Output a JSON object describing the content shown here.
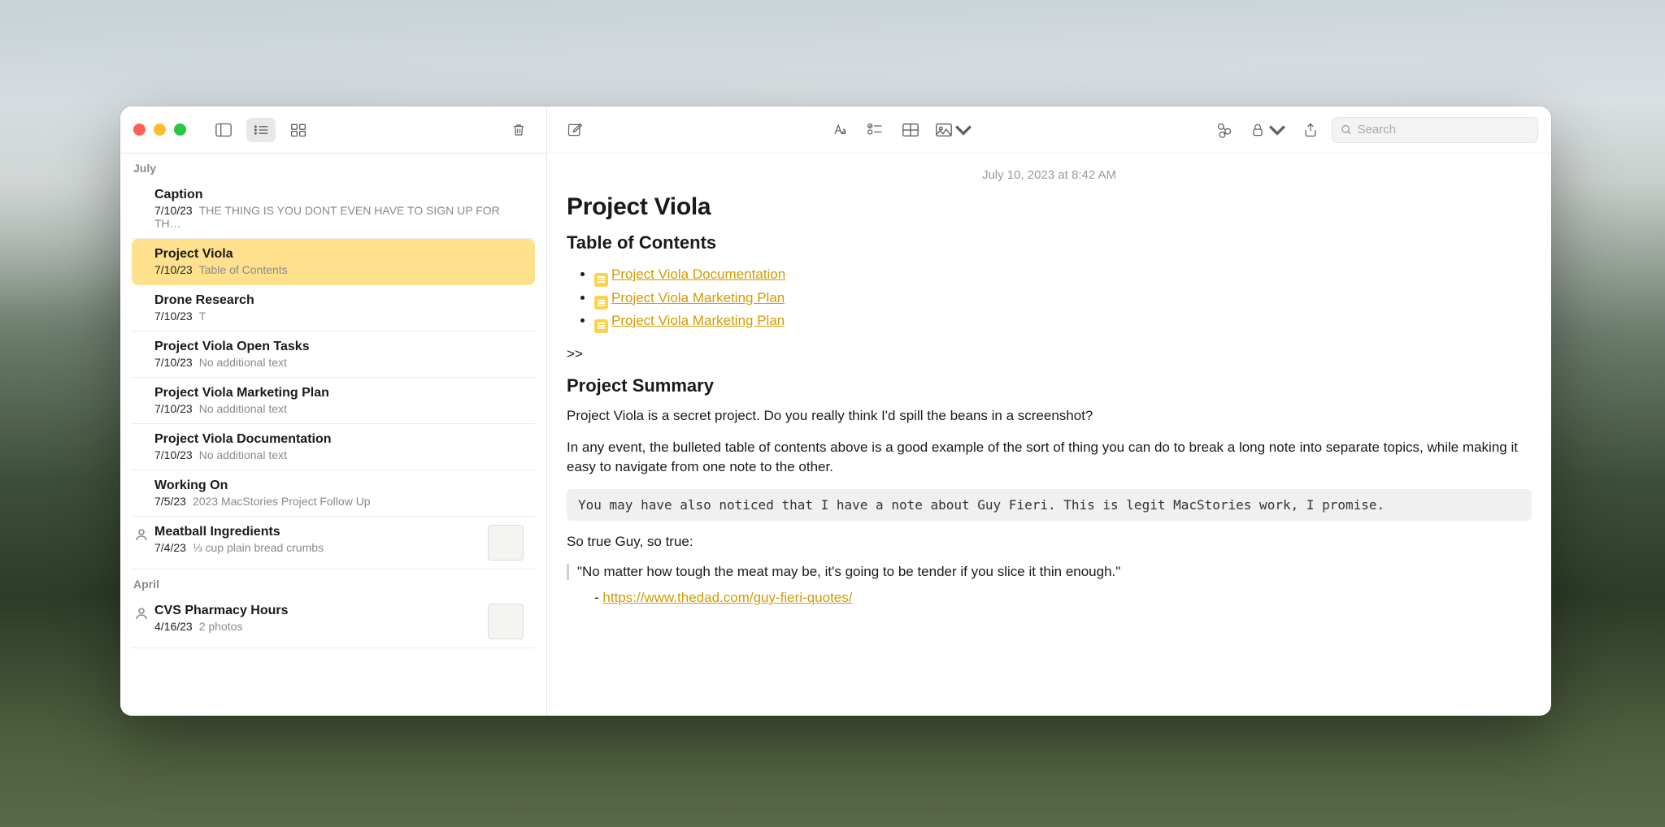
{
  "sidebar": {
    "groups": [
      {
        "label": "July",
        "items": [
          {
            "title": "Caption",
            "date": "7/10/23",
            "preview": "THE THING IS YOU DONT EVEN HAVE TO SIGN UP FOR TH…",
            "selected": false,
            "shared": false,
            "thumb": false
          },
          {
            "title": "Project Viola",
            "date": "7/10/23",
            "preview": "Table of Contents",
            "selected": true,
            "shared": false,
            "thumb": false
          },
          {
            "title": "Drone Research",
            "date": "7/10/23",
            "preview": "T",
            "selected": false,
            "shared": false,
            "thumb": false
          },
          {
            "title": "Project Viola Open Tasks",
            "date": "7/10/23",
            "preview": "No additional text",
            "selected": false,
            "shared": false,
            "thumb": false
          },
          {
            "title": "Project Viola Marketing Plan",
            "date": "7/10/23",
            "preview": "No additional text",
            "selected": false,
            "shared": false,
            "thumb": false
          },
          {
            "title": "Project Viola Documentation",
            "date": "7/10/23",
            "preview": "No additional text",
            "selected": false,
            "shared": false,
            "thumb": false
          },
          {
            "title": "Working On",
            "date": "7/5/23",
            "preview": "2023 MacStories Project Follow Up",
            "selected": false,
            "shared": false,
            "thumb": false
          },
          {
            "title": "Meatball Ingredients",
            "date": "7/4/23",
            "preview": "⅓ cup plain bread crumbs",
            "selected": false,
            "shared": true,
            "thumb": true
          }
        ]
      },
      {
        "label": "April",
        "items": [
          {
            "title": "CVS Pharmacy Hours",
            "date": "4/16/23",
            "preview": "2 photos",
            "selected": false,
            "shared": true,
            "thumb": true
          }
        ]
      }
    ]
  },
  "toolbar": {
    "search_placeholder": "Search"
  },
  "note": {
    "timestamp": "July 10, 2023 at 8:42 AM",
    "title": "Project Viola",
    "toc_heading": "Table of Contents",
    "toc": [
      "Project Viola Documentation",
      "Project Viola Marketing Plan",
      "Project Viola Marketing Plan"
    ],
    "chevrons": ">>",
    "summary_heading": "Project Summary",
    "p1": "Project Viola is a secret project. Do you really think I'd spill the beans in a screenshot?",
    "p2": "In any event, the bulleted table of contents above is a good example of the sort of thing you can do to break a long note into separate topics, while making it easy to navigate from one note to the other.",
    "code": "You may have also noticed that I have a note about Guy Fieri. This is legit MacStories work, I promise.",
    "p3": "So true Guy, so true:",
    "quote": "\"No matter how tough the meat may be, it's going to be tender if you slice it thin enough.\"",
    "ref_dash": "- ",
    "ref_url": "https://www.thedad.com/guy-fieri-quotes/"
  }
}
